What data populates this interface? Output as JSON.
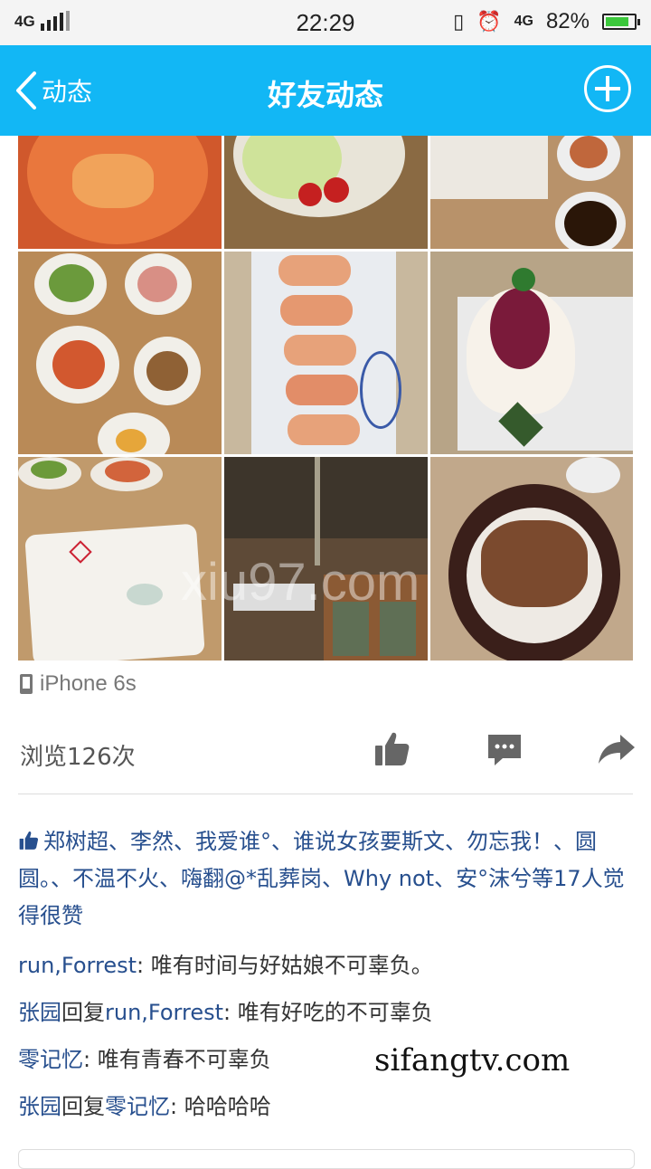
{
  "status_bar": {
    "network": "4G",
    "time": "22:29",
    "network_right": "4G",
    "battery": "82%",
    "battery_level": 0.82
  },
  "nav": {
    "back_label": "动态",
    "title": "好友动态"
  },
  "photos": [
    {
      "name": "photo-hotpot",
      "bg": "#d0582c"
    },
    {
      "name": "photo-salad",
      "bg": "#8a6a43"
    },
    {
      "name": "photo-sauce-dishes",
      "bg": "#d9cfc2"
    },
    {
      "name": "photo-side-dishes",
      "bg": "#b98a57"
    },
    {
      "name": "photo-sushi-roll",
      "bg": "#c8b89e"
    },
    {
      "name": "photo-dessert",
      "bg": "#b7a487"
    },
    {
      "name": "photo-plate",
      "bg": "#e5ddd0"
    },
    {
      "name": "photo-restaurant",
      "bg": "#5e4a37"
    },
    {
      "name": "photo-sizzling-beef",
      "bg": "#6b3d2a"
    }
  ],
  "watermark_image": "xiu97.com",
  "device": "iPhone 6s",
  "views": "浏览126次",
  "likes": {
    "names": "郑树超、李然、我爱谁°、谁说女孩要斯文、勿忘我！、圆圆。、不温不火、嗨翻@*乱葬岗、Why not、安°沫兮",
    "suffix": "等17人觉得很赞"
  },
  "comments": [
    {
      "name": "run,Forrest",
      "reply_to": "",
      "text": ": 唯有时间与好姑娘不可辜负。"
    },
    {
      "name": "张园",
      "reply_word": "回复",
      "reply_to": "run,Forrest",
      "text": ": 唯有好吃的不可辜负"
    },
    {
      "name": "零记忆",
      "reply_to": "",
      "text": ": 唯有青春不可辜负"
    },
    {
      "name": "张园",
      "reply_word": "回复",
      "reply_to": "零记忆",
      "text": ": 哈哈哈哈"
    }
  ],
  "watermark_footer": "sifangtv.com",
  "colors": {
    "navbar": "#12b7f5",
    "link": "#274f8e",
    "icon": "#666666"
  }
}
